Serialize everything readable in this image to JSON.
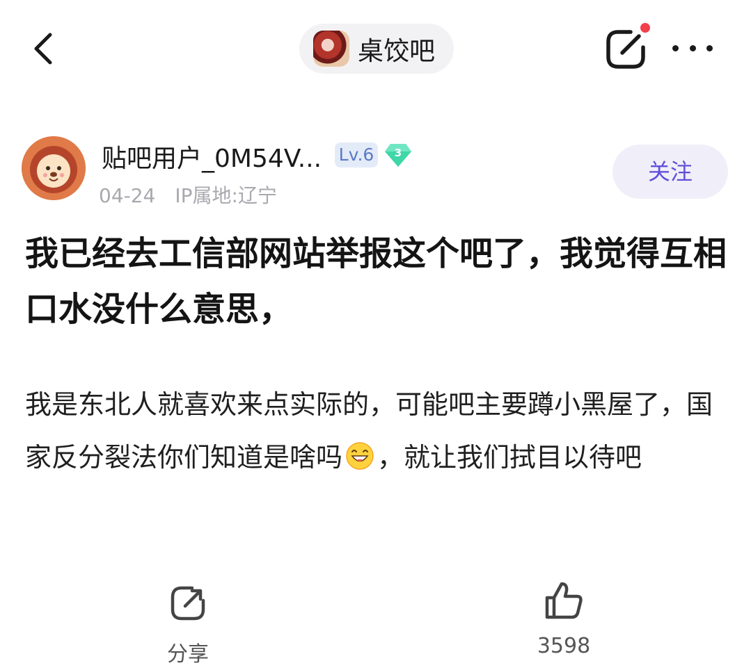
{
  "nav": {
    "forum_name": "桌饺吧"
  },
  "author": {
    "name": "贴吧用户_0M54V...",
    "level": "Lv.6",
    "gem_level": "3",
    "date": "04-24",
    "ip_location": "IP属地:辽宁",
    "follow_label": "关注"
  },
  "post": {
    "title": "我已经去工信部网站举报这个吧了，我觉得互相口水没什么意思，",
    "body_part1": "我是东北人就喜欢来点实际的，可能吧主要蹲小黑屋了，国家反分裂法你们知道是啥吗",
    "body_part2": "，就让我们拭目以待吧"
  },
  "actions": {
    "share_label": "分享",
    "like_count": "3598"
  },
  "colors": {
    "accent": "#6050d8",
    "follow_bg": "#f0eff9",
    "level_bg": "#e4ebf8",
    "level_text": "#5b7bc4",
    "gem": "#3fd6a8",
    "notification_dot": "#f2414b",
    "meta_text": "#a8a8ae"
  }
}
